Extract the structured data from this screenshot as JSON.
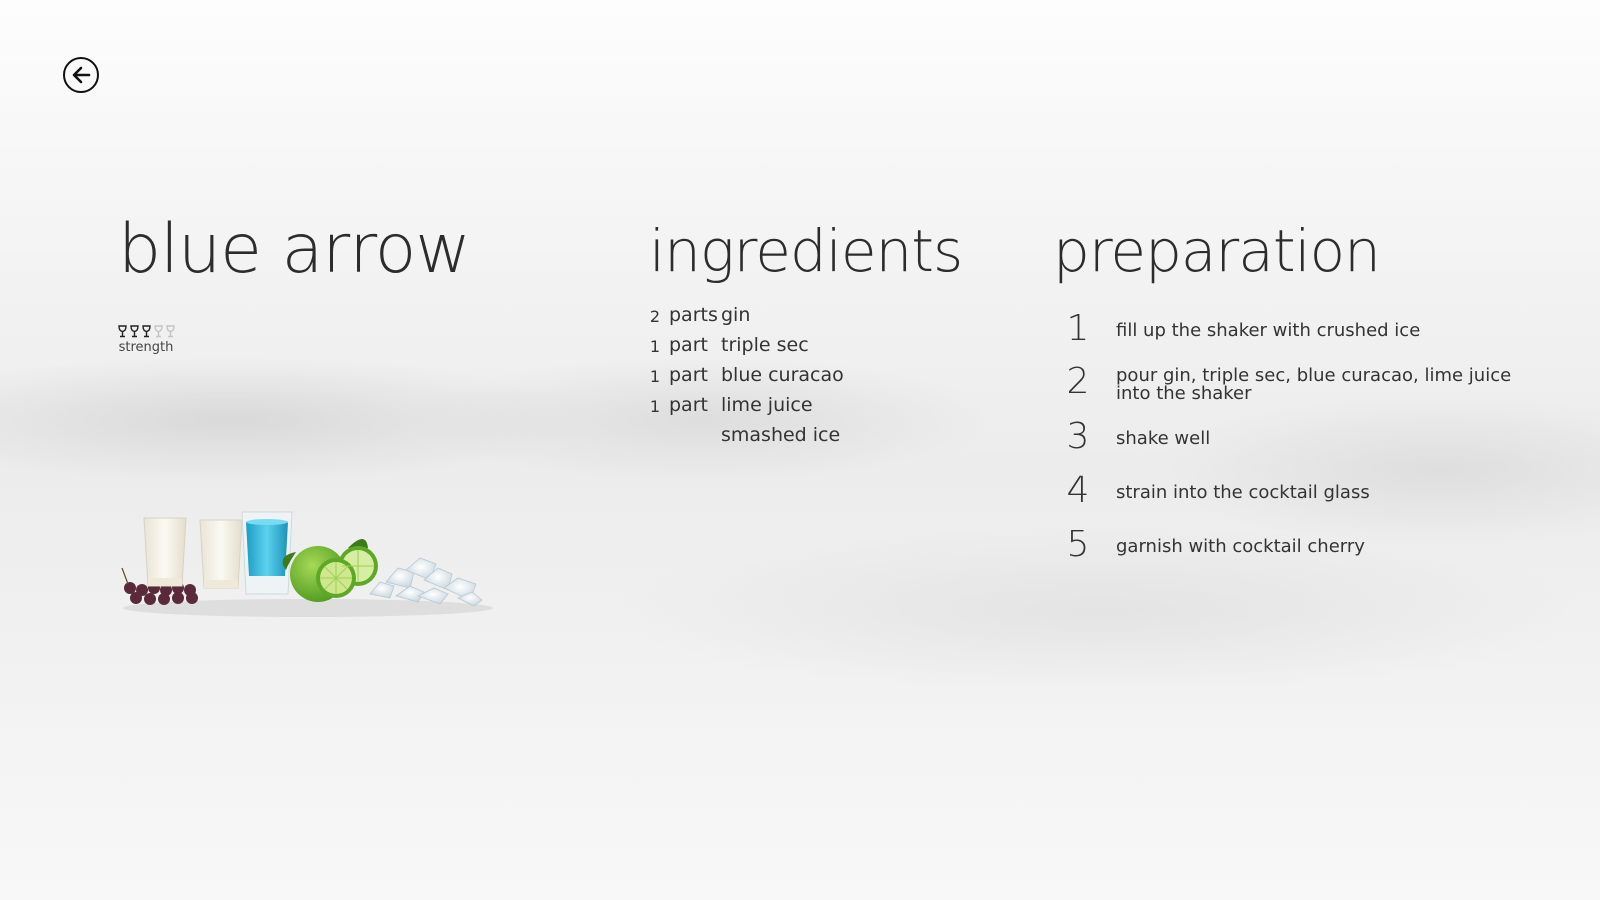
{
  "back": {
    "icon": "back-arrow-icon"
  },
  "drink": {
    "title": "blue arrow",
    "strength": {
      "label": "strength",
      "level": 3,
      "max": 5,
      "icon": "wine-glass-icon"
    }
  },
  "ingredients": {
    "title": "ingredients",
    "items": [
      {
        "qty": "2",
        "unit": "parts",
        "name": "gin"
      },
      {
        "qty": "1",
        "unit": "part",
        "name": "triple sec"
      },
      {
        "qty": "1",
        "unit": "part",
        "name": "blue curacao"
      },
      {
        "qty": "1",
        "unit": "part",
        "name": "lime juice"
      },
      {
        "qty": "",
        "unit": "",
        "name": "smashed ice"
      }
    ]
  },
  "preparation": {
    "title": "preparation",
    "steps": [
      {
        "num": "1",
        "text": "fill up the shaker with crushed ice"
      },
      {
        "num": "2",
        "text": "pour gin, triple sec, blue curacao, lime juice into the shaker"
      },
      {
        "num": "3",
        "text": "shake well"
      },
      {
        "num": "4",
        "text": "strain into the cocktail glass"
      },
      {
        "num": "5",
        "text": "garnish with cocktail cherry"
      }
    ]
  },
  "colors": {
    "accent_blue": "#3fb6d6",
    "lime_green": "#6fb62c",
    "cherry": "#5a2a3a"
  }
}
